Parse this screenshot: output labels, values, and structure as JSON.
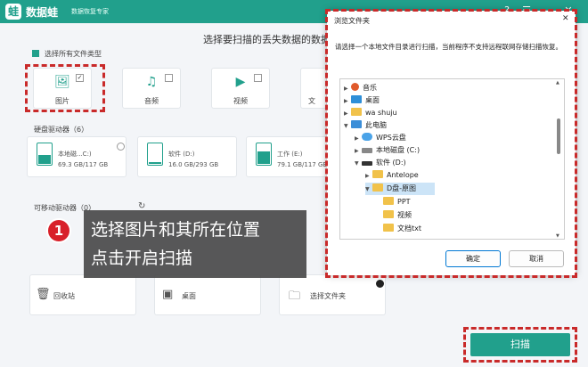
{
  "app": {
    "logo_icon": "frog-logo-icon",
    "title": "数据蛙",
    "subtitle": "数据恢复专家"
  },
  "main": {
    "heading": "选择要扫描的丢失数据的数据",
    "select_all": "选择所有文件类型",
    "file_types": [
      {
        "label": "图片",
        "icon": "image-icon",
        "checked": true
      },
      {
        "label": "音频",
        "icon": "music-icon",
        "checked": false
      },
      {
        "label": "视频",
        "icon": "video-icon",
        "checked": false
      },
      {
        "label": "文",
        "icon": "document-icon",
        "checked": false
      }
    ],
    "hard_drives_label": "硬盘驱动器（6）",
    "drives": [
      {
        "name": "本地磁...C:)",
        "size": "69.3 GB/117 GB"
      },
      {
        "name": "软件 (D:)",
        "size": "16.0 GB/293 GB"
      },
      {
        "name": "工作 (E:)",
        "size": "79.1 GB/117 GB"
      }
    ],
    "removable_label": "可移动驱动器（0）",
    "quick_locations": [
      {
        "label": "回收站",
        "icon": "trash-icon"
      },
      {
        "label": "桌面",
        "icon": "desktop-icon"
      },
      {
        "label": "选择文件夹",
        "icon": "folder-icon"
      }
    ],
    "scan_button": "扫描"
  },
  "callout": {
    "number": "1",
    "line1": "选择图片和其所在位置",
    "line2": "点击开启扫描"
  },
  "dialog": {
    "title": "浏览文件夹",
    "close": "✕",
    "message": "请选择一个本地文件目录进行扫描，当前程序不支持远程联网存储扫描恢复。",
    "tree": [
      {
        "label": "音乐",
        "icon": "music-folder-icon",
        "arrow": "▶"
      },
      {
        "label": "桌面",
        "icon": "desktop-folder-icon",
        "arrow": "▶"
      },
      {
        "label": "wa shuju",
        "icon": "folder-icon",
        "arrow": "▶"
      },
      {
        "label": "此电脑",
        "icon": "computer-icon",
        "arrow": "▼"
      },
      {
        "label": "WPS云盘",
        "icon": "cloud-icon",
        "arrow": "▶"
      },
      {
        "label": "本地磁盘 (C:)",
        "icon": "drive-icon",
        "arrow": "▶"
      },
      {
        "label": "软件 (D:)",
        "icon": "drive-icon",
        "arrow": "▼"
      },
      {
        "label": "Antelope",
        "icon": "folder-icon",
        "arrow": "▶"
      },
      {
        "label": "D盘-原图",
        "icon": "folder-icon",
        "arrow": "▼"
      },
      {
        "label": "PPT",
        "icon": "folder-icon",
        "arrow": ""
      },
      {
        "label": "视频",
        "icon": "folder-icon",
        "arrow": ""
      },
      {
        "label": "文档txt",
        "icon": "folder-icon",
        "arrow": ""
      }
    ],
    "ok": "确定",
    "cancel": "取消"
  },
  "colors": {
    "accent": "#21a08c",
    "highlight": "#c92a2a",
    "callout_bg": "#464646",
    "selection": "#cce4f7"
  }
}
